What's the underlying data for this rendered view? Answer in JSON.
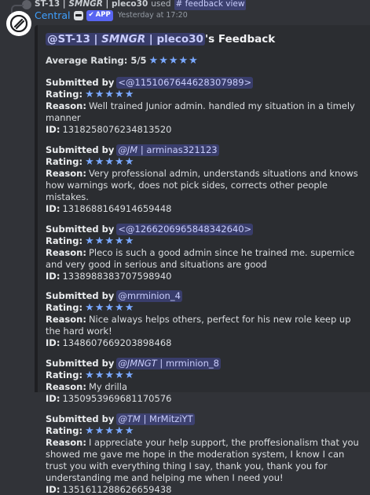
{
  "reply": {
    "author_role": "ST-13 |",
    "author_org": "SMNGR",
    "author_sep": " | pleco30",
    "verb": "used",
    "command": "# feedback view"
  },
  "header": {
    "bot_name": "Central",
    "app_badge": "APP",
    "timestamp": "Yesterday at 17:20"
  },
  "embed": {
    "title_mention_a": "@ST-13 | ",
    "title_mention_b": "SMNGR",
    "title_mention_c": " | pleco30",
    "title_suffix": "'s Feedback",
    "avg_label": "Average Rating: 5/5",
    "labels": {
      "submitted": "Submitted by",
      "rating": "Rating:",
      "reason": "Reason:",
      "id": "ID:"
    },
    "entries": [
      {
        "sub_a": "<@1151067644628307989>",
        "sub_b": "",
        "sub_c": "",
        "sub_d": "",
        "reason": "Well trained Junior admin. handled my situation in a timely manner",
        "id": "1318258076234813520"
      },
      {
        "sub_a": "@JM",
        "sub_b": " | ",
        "sub_c": "arminas321123",
        "sub_d": "",
        "reason": "Very professional admin, understands situations and knows how warnings work, does not pick sides, corrects other people mistakes.",
        "id": "1318688164914659448"
      },
      {
        "sub_a": "<@1266206965848342640>",
        "sub_b": "",
        "sub_c": "",
        "sub_d": "",
        "reason": "Pleco is such a good admin since he trained me. supernice and very good in serious and situations are good",
        "id": "1338988383707598940"
      },
      {
        "sub_a": "@mrminion_4",
        "sub_b": "",
        "sub_c": "",
        "sub_d": "",
        "reason": "Nice always helps others, perfect for his new role keep up the hard work!",
        "id": "1348607669203898468"
      },
      {
        "sub_a": "@JMNGT",
        "sub_b": " | ",
        "sub_c": "mrminion_8",
        "sub_d": "",
        "reason": "My drilla",
        "id": "1350953969681170576"
      },
      {
        "sub_a": "@TM",
        "sub_b": " | ",
        "sub_c": "MrMitziYT",
        "sub_d": "",
        "reason": "I appreciate your help support, the proffesionalism that you showed me gave me hope in the moderation system, I know I can trust you with everything thing I say, thank you, thank you for understanding me and helping me when I need you!",
        "id": "1351611288626659438"
      }
    ]
  },
  "colors": {
    "background": "#313338",
    "embed": "#2b2d31",
    "link": "#3fa0ff",
    "star": "#79a8ff",
    "mention_bg": "#5865f24d"
  },
  "icons": [
    "reply-spine",
    "avatar-logo-icon",
    "robot-icon",
    "checkmark-icon",
    "star-icon"
  ]
}
